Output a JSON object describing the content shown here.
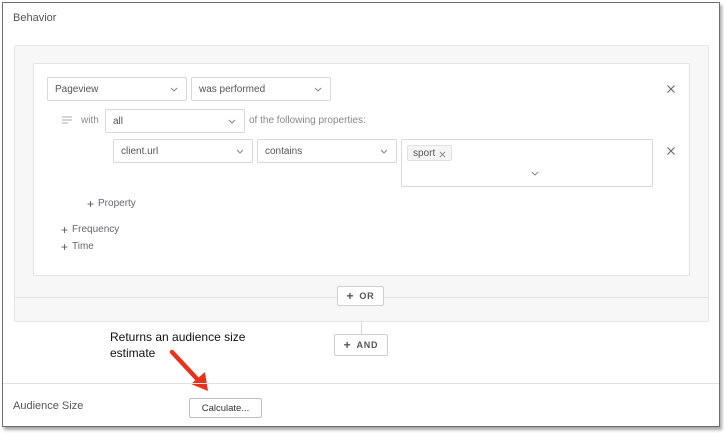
{
  "behavior": {
    "title": "Behavior",
    "event_select": {
      "value": "Pageview"
    },
    "action_select": {
      "value": "was performed"
    },
    "with_label": "with",
    "quantifier_select": {
      "value": "all"
    },
    "properties_suffix": "of the following properties:",
    "property_row": {
      "field_select": {
        "value": "client.url"
      },
      "operator_select": {
        "value": "contains"
      },
      "tags": [
        "sport"
      ]
    },
    "add_property_label": "Property",
    "add_frequency_label": "Frequency",
    "add_time_label": "Time",
    "or_button_label": "OR",
    "and_button_label": "AND"
  },
  "annotation": {
    "text": "Returns an audience size estimate",
    "arrow_color": "#e8321e"
  },
  "audience": {
    "title": "Audience Size",
    "calculate_button_label": "Calculate..."
  },
  "icons": {
    "chevron": "chevron-down-icon",
    "close": "close-icon",
    "plus": "plus-icon",
    "lines": "lines-icon"
  }
}
